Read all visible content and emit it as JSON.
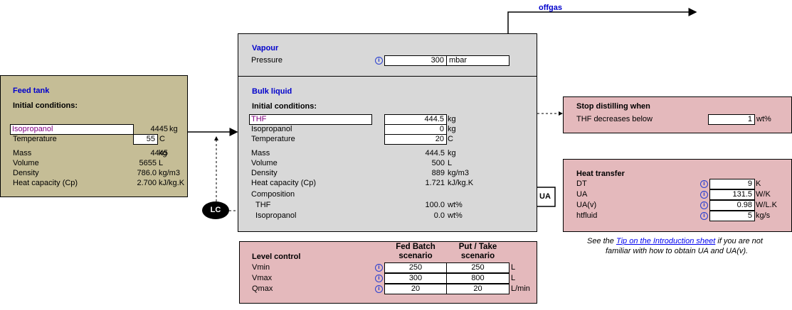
{
  "offgas_label": "offgas",
  "feed_tank": {
    "title": "Feed tank",
    "initial_conditions": "Initial conditions:",
    "component": {
      "value": "Isopropanol",
      "amount": "4445",
      "unit": "kg"
    },
    "temperature": {
      "label": "Temperature",
      "value": "55",
      "unit": "C"
    },
    "rows": [
      {
        "label": "Mass",
        "value": "4445",
        "unit": "kg"
      },
      {
        "label": "Volume",
        "value": "5655",
        "unit": "L"
      },
      {
        "label": "Density",
        "value": "786.0",
        "unit": "kg/m3"
      },
      {
        "label": "Heat capacity (Cp)",
        "value": "2.700",
        "unit": "kJ/kg.K"
      }
    ]
  },
  "vapour": {
    "title": "Vapour",
    "pressure": {
      "label": "Pressure",
      "value": "300",
      "unit": "mbar"
    }
  },
  "bulk_liquid": {
    "title": "Bulk liquid",
    "initial_conditions": "Initial conditions:",
    "thf": {
      "value": "THF",
      "amount": "444.5",
      "unit": "kg"
    },
    "isopropanol": {
      "label": "Isopropanol",
      "value": "0",
      "unit": "kg"
    },
    "temperature": {
      "label": "Temperature",
      "value": "20",
      "unit": "C"
    },
    "rows": [
      {
        "label": "Mass",
        "value": "444.5",
        "unit": "kg"
      },
      {
        "label": "Volume",
        "value": "500",
        "unit": "L"
      },
      {
        "label": "Density",
        "value": "889",
        "unit": "kg/m3"
      },
      {
        "label": "Heat capacity (Cp)",
        "value": "1.721",
        "unit": "kJ/kg.K"
      }
    ],
    "composition_label": "Composition",
    "composition": [
      {
        "label": "THF",
        "value": "100.0",
        "unit": "wt%"
      },
      {
        "label": "Isopropanol",
        "value": "0.0",
        "unit": "wt%"
      }
    ]
  },
  "ua_label": "UA",
  "lc_label": "LC",
  "stop_distilling": {
    "title": "Stop distilling when",
    "label": "THF decreases below",
    "value": "1",
    "unit": "wt%"
  },
  "heat_transfer": {
    "title": "Heat transfer",
    "rows": [
      {
        "label": "DT",
        "value": "9",
        "unit": "K"
      },
      {
        "label": "UA",
        "value": "131.5",
        "unit": "W/K"
      },
      {
        "label": "UA(v)",
        "value": "0.98",
        "unit": "W/L.K"
      },
      {
        "label": "htfluid",
        "value": "5",
        "unit": "kg/s"
      }
    ]
  },
  "note": {
    "prefix": "See the ",
    "link": "Tip on the Introduction sheet",
    "suffix": " if you are not",
    "line2": "familiar with how to obtain UA and UA(v)."
  },
  "level_control": {
    "title": "Level control",
    "col1": [
      "Fed Batch",
      "scenario"
    ],
    "col2": [
      "Put / Take",
      "scenario"
    ],
    "rows": [
      {
        "label": "Vmin",
        "v1": "250",
        "v2": "250",
        "unit": "L"
      },
      {
        "label": "Vmax",
        "v1": "300",
        "v2": "800",
        "unit": "L"
      },
      {
        "label": "Qmax",
        "v1": "20",
        "v2": "20",
        "unit": "L/min"
      }
    ]
  },
  "colors": {
    "tan": "#c5bd96",
    "grey": "#d8d8d8",
    "pink": "#e4b9bc",
    "title_blue": "#0000cc"
  }
}
